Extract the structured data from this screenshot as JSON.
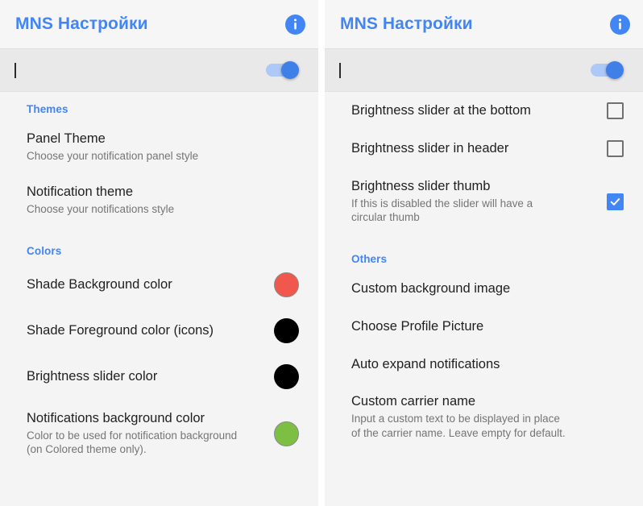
{
  "window": {
    "panel_count": 2
  },
  "left_panel": {
    "header": {
      "title": "MNS Настройки",
      "info_icon": "info-circle-icon",
      "title_color": "#4285F4"
    },
    "search": {
      "value": "",
      "placeholder": "",
      "toggle_on": true,
      "toggle_on_color": "#3F7FE8",
      "toggle_track_color": "#AEC8F7"
    },
    "sections": [
      {
        "header": "Themes",
        "items": [
          {
            "title": "Panel Theme",
            "summary": "Choose your notification panel style",
            "widget": "none"
          },
          {
            "title": "Notification theme",
            "summary": "Choose your notifications style",
            "widget": "none"
          }
        ]
      },
      {
        "header": "Colors",
        "items": [
          {
            "title": "Shade Background color",
            "summary": "",
            "widget": "color-dot",
            "color": "#F0584E",
            "bordered": true
          },
          {
            "title": "Shade Foreground color (icons)",
            "summary": "",
            "widget": "color-dot",
            "color": "#000000",
            "bordered": false
          },
          {
            "title": "Brightness slider color",
            "summary": "",
            "widget": "color-dot",
            "color": "#000000",
            "bordered": false
          },
          {
            "title": "Notifications background color",
            "summary": "Color to be used for notification background (on Colored theme only).",
            "widget": "color-dot",
            "color": "#7CBF42",
            "bordered": true
          }
        ]
      }
    ]
  },
  "right_panel": {
    "header": {
      "title": "MNS Настройки",
      "info_icon": "info-circle-icon",
      "title_color": "#4285F4"
    },
    "search": {
      "value": "",
      "placeholder": "",
      "toggle_on": true,
      "toggle_on_color": "#3F7FE8",
      "toggle_track_color": "#AEC8F7"
    },
    "sections": [
      {
        "header": "",
        "items": [
          {
            "title": "Brightness slider at the bottom",
            "summary": "",
            "widget": "checkbox",
            "checked": false
          },
          {
            "title": "Brightness slider in header",
            "summary": "",
            "widget": "checkbox",
            "checked": false
          },
          {
            "title": "Brightness slider thumb",
            "summary": "If this is disabled the slider will have a circular thumb",
            "widget": "checkbox",
            "checked": true
          }
        ]
      },
      {
        "header": "Others",
        "items": [
          {
            "title": "Custom background image",
            "summary": "",
            "widget": "none"
          },
          {
            "title": "Choose Profile Picture",
            "summary": "",
            "widget": "none"
          },
          {
            "title": "Auto expand notifications",
            "summary": "",
            "widget": "none"
          },
          {
            "title": "Custom carrier name",
            "summary": "Input a custom text to be displayed in place of the carrier name. Leave empty for default.",
            "widget": "none"
          }
        ]
      }
    ]
  }
}
